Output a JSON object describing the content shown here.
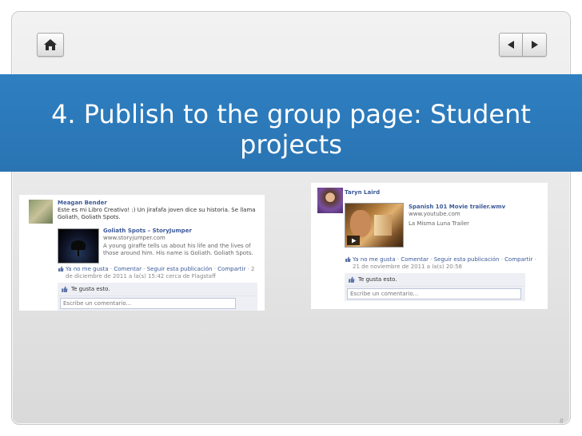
{
  "slide": {
    "title": "4. Publish to the group page: Student projects",
    "slide_number": "8",
    "colors": {
      "title_band": "#2e7fc1",
      "frame": "#e6e6e6",
      "fb_link": "#3b5998"
    }
  },
  "navigation": {
    "home_icon": "home-icon",
    "prev_icon": "triangle-left-icon",
    "next_icon": "triangle-right-icon"
  },
  "left_post": {
    "poster": "Meagan Bender",
    "text": "Este es mi Libro Creativo! :) Un jirafafa joven dice su historia. Se llama Goliath, Goliath Spots.",
    "link_title": "Goliath Spots – StoryJumper",
    "link_url": "www.storyjumper.com",
    "link_desc": "A young giraffe tells us about his life and the lives of those around him. His name is Goliath. Goliath Spots.",
    "actions": {
      "unlike": "Ya no me gusta",
      "comment": "Comentar",
      "follow": "Seguir esta publicación",
      "share": "Compartir",
      "meta": "2 de diciembre de 2011 a la(s) 15:42 cerca de Flagstaff"
    },
    "likes": "Te gusta esto.",
    "comment_placeholder": "Escribe un comentario..."
  },
  "right_post": {
    "poster": "Taryn Laird",
    "link_title": "Spanish 101 Movie trailer.wmv",
    "link_url": "www.youtube.com",
    "link_desc": "La Misma Luna Trailer",
    "actions": {
      "unlike": "Ya no me gusta",
      "comment": "Comentar",
      "follow": "Seguir esta publicación",
      "share": "Compartir",
      "meta": "21 de noviembre de 2011 a la(s) 20:58"
    },
    "likes": "Te gusta esto.",
    "comment_placeholder": "Escribe un comentario..."
  }
}
